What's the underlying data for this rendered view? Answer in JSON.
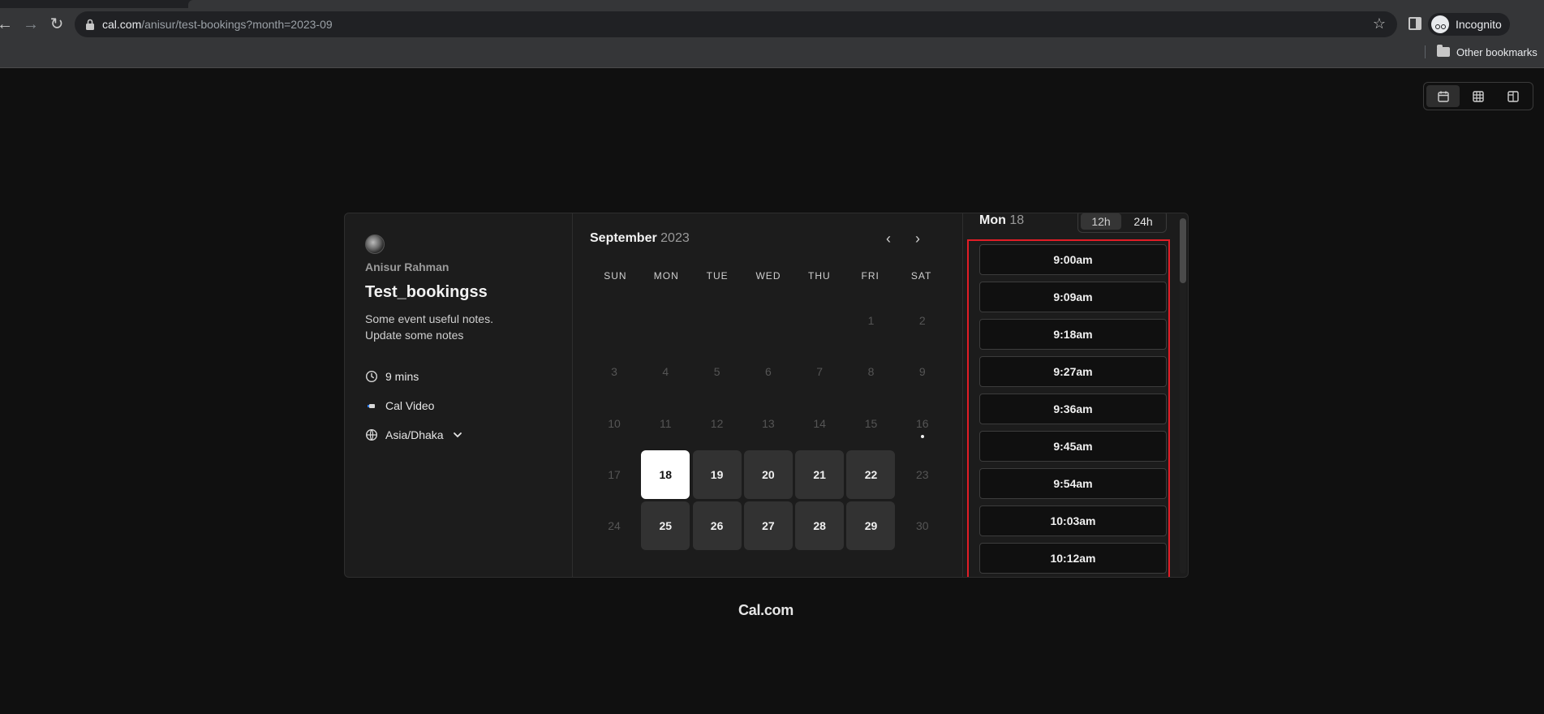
{
  "browser": {
    "url_host": "cal.com",
    "url_path": "/anisur/test-bookings?month=2023-09",
    "profile_label": "Incognito",
    "bookmark_folder": "Other bookmarks"
  },
  "layout_toggle": {
    "options": [
      "month-view",
      "week-view",
      "column-view"
    ],
    "active": "month-view"
  },
  "event": {
    "host": "Anisur Rahman",
    "title": "Test_bookingss",
    "description_line1": "Some event useful notes.",
    "description_line2": "Update some notes",
    "duration": "9 mins",
    "location": "Cal Video",
    "timezone": "Asia/Dhaka"
  },
  "calendar": {
    "month": "September",
    "year": "2023",
    "weekdays": [
      "SUN",
      "MON",
      "TUE",
      "WED",
      "THU",
      "FRI",
      "SAT"
    ],
    "selected_day": "18"
  },
  "slots": {
    "day_name": "Mon",
    "day_number": "18",
    "format_12h": "12h",
    "format_24h": "24h",
    "active_format": "12h",
    "times": [
      "9:00am",
      "9:09am",
      "9:18am",
      "9:27am",
      "9:36am",
      "9:45am",
      "9:54am",
      "10:03am",
      "10:12am"
    ]
  },
  "footer": {
    "brand": "Cal.com"
  },
  "colors": {
    "highlight_frame": "#e11d26",
    "background": "#101010",
    "panel": "#1c1c1c"
  }
}
